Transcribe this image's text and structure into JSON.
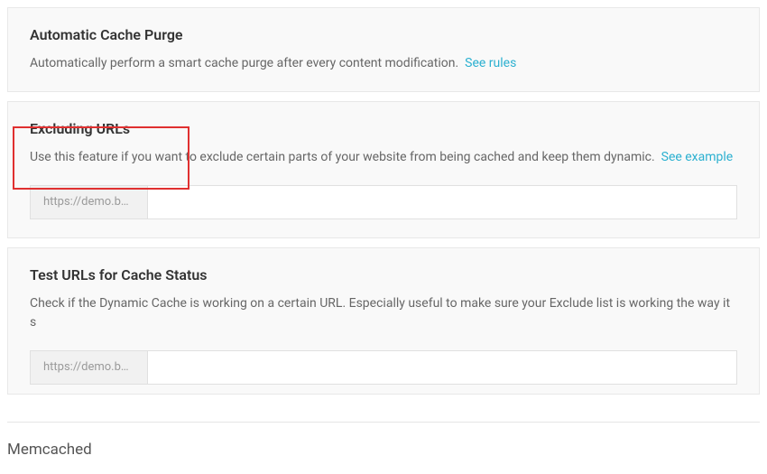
{
  "autoPurge": {
    "title": "Automatic Cache Purge",
    "description": "Automatically perform a smart cache purge after every content modification.",
    "link": "See rules"
  },
  "excludingUrls": {
    "title": "Excluding URLs",
    "description": "Use this feature if you want to exclude certain parts of your website from being cached and keep them dynamic.",
    "link": "See example",
    "inputPrefix": "https://demo.b…",
    "inputValue": ""
  },
  "testUrls": {
    "title": "Test URLs for Cache Status",
    "description": "Check if the Dynamic Cache is working on a certain URL. Especially useful to make sure your Exclude list is working the way it s",
    "inputPrefix": "https://demo.b…",
    "inputValue": ""
  },
  "memcached": {
    "title": "Memcached"
  }
}
